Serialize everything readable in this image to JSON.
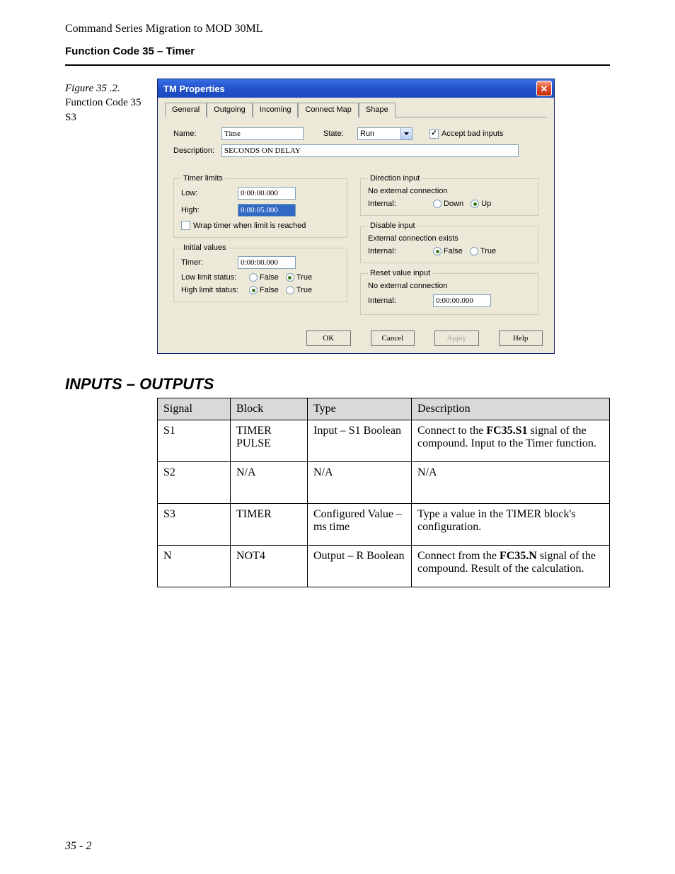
{
  "doc_header": {
    "line1": "Command Series Migration to MOD 30ML",
    "line2": "Function Code 35 – Timer"
  },
  "figure_caption": {
    "title": "Figure 35 .2.",
    "sub1": "Function Code 35",
    "sub2": "S3"
  },
  "dialog": {
    "title": "TM Properties",
    "tabs": [
      "General",
      "Outgoing",
      "Incoming",
      "Connect Map",
      "Shape"
    ],
    "labels": {
      "name": "Name:",
      "state": "State:",
      "accept_bad": "Accept bad inputs",
      "description": "Description:",
      "timer_limits": "Timer limits",
      "low": "Low:",
      "high": "High:",
      "wrap": "Wrap timer when limit is reached",
      "initial_values": "Initial values",
      "timer": "Timer:",
      "low_limit_status": "Low limit status:",
      "high_limit_status": "High limit status:",
      "direction_input": "Direction input",
      "no_ext": "No external connection",
      "internal": "Internal:",
      "down": "Down",
      "up": "Up",
      "disable_input": "Disable input",
      "ext_exists": "External connection exists",
      "false": "False",
      "true": "True",
      "reset_value_input": "Reset value input"
    },
    "values": {
      "name": "Time",
      "state": "Run",
      "description": "SECONDS ON DELAY",
      "low": "0:00:00.000",
      "high": "0:00:05.000",
      "timer": "0:00:00.000",
      "reset": "0:00:00.000"
    },
    "buttons": {
      "ok": "OK",
      "cancel": "Cancel",
      "apply": "Apply",
      "help": "Help"
    }
  },
  "section_title": "INPUTS – OUTPUTS",
  "table": {
    "headers": [
      "Signal",
      "Block",
      "Type",
      "Description"
    ],
    "rows": [
      {
        "signal": "S1",
        "block": "TIMER PULSE",
        "type": "Input – S1 Boolean",
        "desc_pre": "Connect to the ",
        "desc_bold": "FC35.S1",
        "desc_post": " signal of the compound. Input to the Timer function."
      },
      {
        "signal": "S2",
        "block": "N/A",
        "type": "N/A",
        "desc_pre": "N/A",
        "desc_bold": "",
        "desc_post": ""
      },
      {
        "signal": "S3",
        "block": "TIMER",
        "type": "Configured Value – ms time",
        "desc_pre": "Type a value in the TIMER block's configuration.",
        "desc_bold": "",
        "desc_post": ""
      },
      {
        "signal": "N",
        "block": "NOT4",
        "type": "Output – R Boolean",
        "desc_pre": "Connect from the ",
        "desc_bold": "FC35.N",
        "desc_post": " signal of the compound. Result of the calculation."
      }
    ]
  },
  "page_number": "35 - 2"
}
